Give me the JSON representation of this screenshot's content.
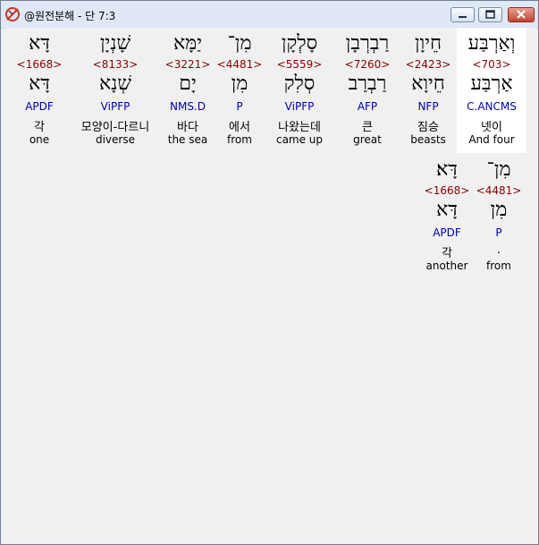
{
  "window": {
    "title": "@원전분해 - 단 7:3"
  },
  "rows": [
    {
      "words": [
        {
          "hebrew": "דָּא",
          "strong": "<1668>",
          "lemma": "דָּא",
          "morph": "APDF",
          "korean": "각",
          "english": "one"
        },
        {
          "hebrew": "שָׁנְיָן",
          "strong": "<8133>",
          "lemma": "שְׁנָא",
          "morph": "ViPFP",
          "korean": "모양이-다르니",
          "english": "diverse"
        },
        {
          "hebrew": "יַמָּא",
          "strong": "<3221>",
          "lemma": "יָם",
          "morph": "NMS.D",
          "korean": "바다",
          "english": "the sea"
        },
        {
          "hebrew": "מִן־",
          "strong": "<4481>",
          "lemma": "מִן",
          "morph": "P",
          "korean": "에서",
          "english": "from"
        },
        {
          "hebrew": "סָלְקָן",
          "strong": "<5559>",
          "lemma": "סְלִק",
          "morph": "ViPFP",
          "korean": "나왔는데",
          "english": "came up"
        },
        {
          "hebrew": "רַבְרְבָן",
          "strong": "<7260>",
          "lemma": "רַבְרַב",
          "morph": "AFP",
          "korean": "큰",
          "english": "great"
        },
        {
          "hebrew": "חֵיוָן",
          "strong": "<2423>",
          "lemma": "חֵיוָא",
          "morph": "NFP",
          "korean": "짐승",
          "english": "beasts"
        },
        {
          "hebrew": "וְאַרְבַּע",
          "strong": "<703>",
          "lemma": "אַרְבַּע",
          "morph": "C.ANCMS",
          "korean": "넷이",
          "english": "And four",
          "highlighted": true
        }
      ]
    },
    {
      "words": [
        {
          "hebrew": "דָּא׃",
          "strong": "<1668>",
          "lemma": "דָּא",
          "morph": "APDF",
          "korean": "각",
          "english": "another"
        },
        {
          "hebrew": "מִן־",
          "strong": "<4481>",
          "lemma": "מִן",
          "morph": "P",
          "korean": ".",
          "english": "from"
        }
      ]
    }
  ]
}
